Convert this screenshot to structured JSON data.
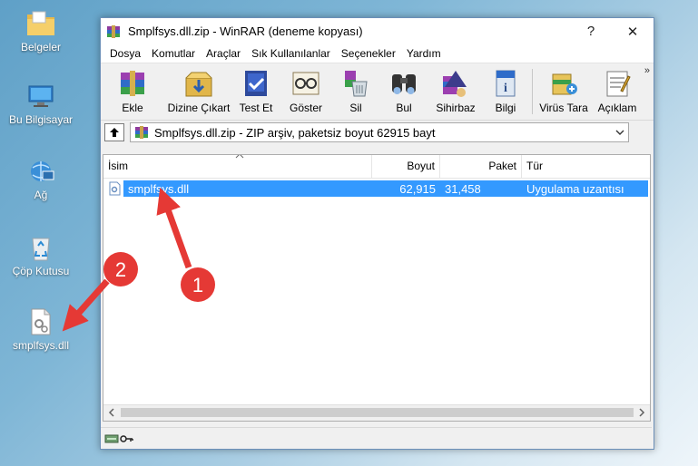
{
  "desktop": {
    "icons": [
      {
        "label": "Belgeler",
        "icon": "folder-icon"
      },
      {
        "label": "Bu Bilgisayar",
        "icon": "computer-icon"
      },
      {
        "label": "Ağ",
        "icon": "network-icon"
      },
      {
        "label": "Çöp Kutusu",
        "icon": "recycle-bin-icon"
      },
      {
        "label": "smplfsys.dll",
        "icon": "dll-file-icon"
      }
    ]
  },
  "window": {
    "title": "Smplfsys.dll.zip - WinRAR (deneme kopyası)",
    "help_label": "?",
    "close_label": "✕"
  },
  "menu": [
    "Dosya",
    "Komutlar",
    "Araçlar",
    "Sık Kullanılanlar",
    "Seçenekler",
    "Yardım"
  ],
  "toolbar": {
    "buttons": [
      {
        "label": "Ekle",
        "icon": "add-archive-icon"
      },
      {
        "label": "Dizine Çıkart",
        "icon": "extract-icon"
      },
      {
        "label": "Test Et",
        "icon": "test-icon"
      },
      {
        "label": "Göster",
        "icon": "view-icon"
      },
      {
        "label": "Sil",
        "icon": "delete-icon"
      },
      {
        "label": "Bul",
        "icon": "find-icon"
      },
      {
        "label": "Sihirbaz",
        "icon": "wizard-icon"
      },
      {
        "label": "Bilgi",
        "icon": "info-icon"
      },
      {
        "label": "Virüs Tara",
        "icon": "virus-scan-icon"
      },
      {
        "label": "Açıklam",
        "icon": "comment-icon"
      }
    ],
    "more": "»"
  },
  "address": {
    "path": "Smplfsys.dll.zip - ZIP arşiv, paketsiz boyut 62915 bayt"
  },
  "columns": {
    "name": "İsim",
    "size": "Boyut",
    "packed": "Paket",
    "type": "Tür"
  },
  "files": [
    {
      "name": "smplfsys.dll",
      "size": "62,915",
      "packed": "31,458",
      "type": "Uygulama uzantısı"
    }
  ],
  "annotations": [
    {
      "number": "1",
      "color": "#e53935"
    },
    {
      "number": "2",
      "color": "#e53935"
    }
  ],
  "colors": {
    "selection": "#3399ff",
    "annotation": "#e53935"
  }
}
